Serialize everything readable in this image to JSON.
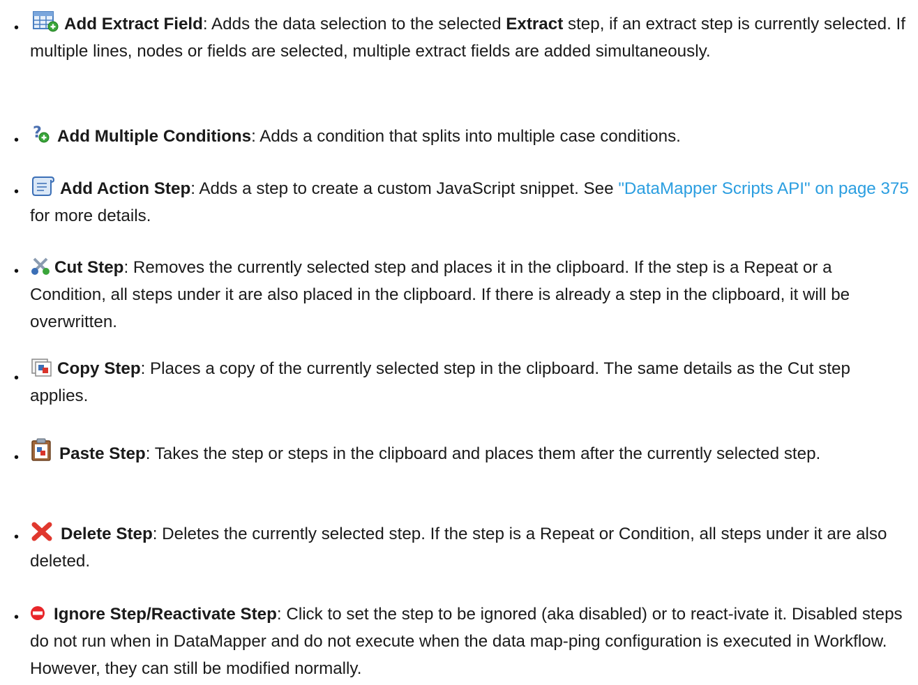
{
  "items": [
    {
      "icon": "add-extract-field-icon",
      "title": "Add Extract Field",
      "pre": ": Adds the data selection to the selected ",
      "bold2": "Extract",
      "post": " step, if an extract step is currently selected. If multiple lines, nodes or fields are selected, multiple extract fields are added simultaneously."
    },
    {
      "icon": "add-multiple-conditions-icon",
      "title": "Add Multiple Conditions",
      "text": ": Adds a condition that splits into multiple case conditions."
    },
    {
      "icon": "add-action-step-icon",
      "title": "Add Action Step",
      "text": ": Adds a step to create a custom JavaScript snippet. See ",
      "link": "\"DataMapper Scripts API\" on page 375",
      "text_after": " for more details."
    },
    {
      "icon": "cut-step-icon",
      "title": "Cut Step",
      "text": ": Removes the currently selected step and places it in the clipboard. If the step is a Repeat or a Condition, all steps under it are also placed in the clipboard. If there is already a step in the clipboard, it will be overwritten."
    },
    {
      "icon": "copy-step-icon",
      "title": "Copy Step",
      "text": ": Places a copy of the currently selected step in the clipboard. The same details as the Cut step applies."
    },
    {
      "icon": "paste-step-icon",
      "title": "Paste Step",
      "text": ": Takes the step or steps in the clipboard and places them after the currently selected step."
    },
    {
      "icon": "delete-step-icon",
      "title": "Delete Step",
      "text": ": Deletes the currently selected step. If the step is a Repeat or Condition, all steps under it are also deleted."
    },
    {
      "icon": "ignore-step-icon",
      "title": "Ignore Step/Reactivate Step",
      "text": ": Click to set the step to be ignored (aka disabled) or to react-ivate it. Disabled steps do not run when in DataMapper and do not execute when the data map-ping configuration is executed in Workflow. However, they can still be modified normally."
    }
  ],
  "colors": {
    "link": "#2b9ee0",
    "text": "#1a1a1a"
  }
}
